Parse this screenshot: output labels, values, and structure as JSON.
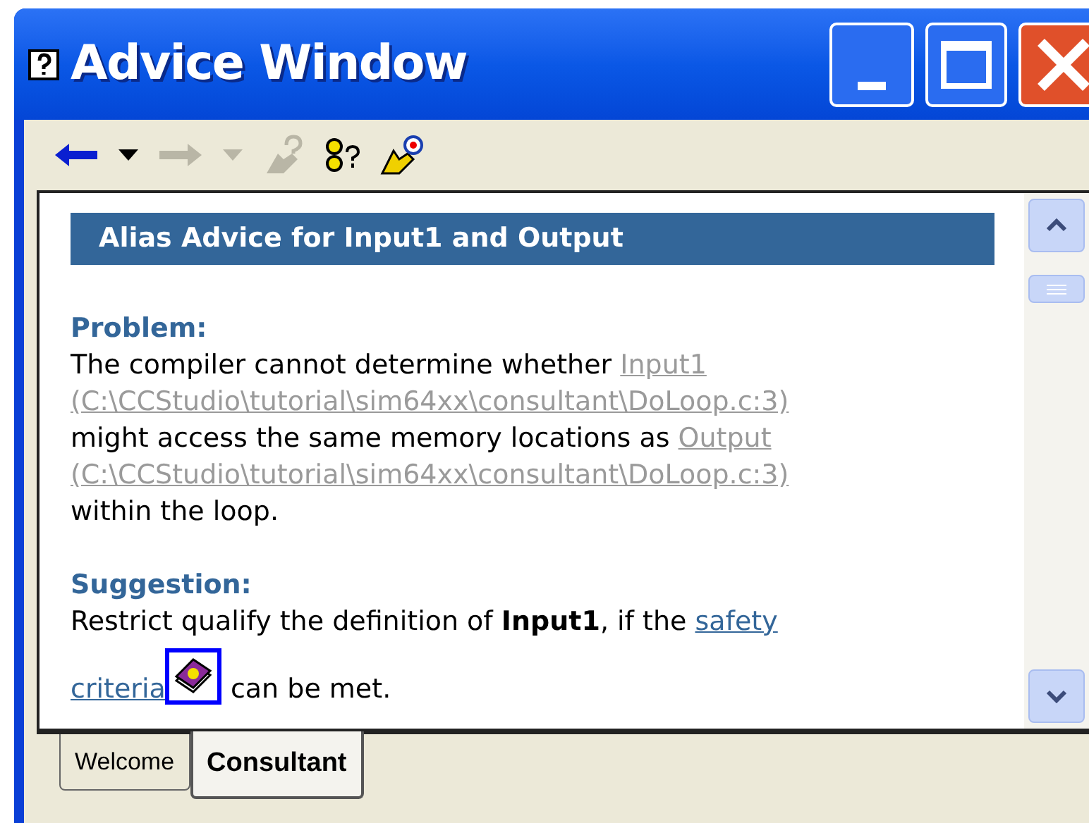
{
  "window": {
    "title": "Advice Window"
  },
  "toolbar": [
    {
      "kind": "back",
      "disabled": false
    },
    {
      "kind": "back_menu",
      "disabled": false
    },
    {
      "kind": "forward",
      "disabled": true
    },
    {
      "kind": "forward_menu",
      "disabled": true
    },
    {
      "kind": "hand_help",
      "disabled": true
    },
    {
      "kind": "help_query",
      "disabled": false
    },
    {
      "kind": "hand_target",
      "disabled": false
    }
  ],
  "advice": {
    "heading": "Alias Advice for Input1 and Output",
    "sections": [
      {
        "title": "Problem:",
        "lines": [
          [
            {
              "kind": "text",
              "text": "The compiler cannot determine whether "
            },
            {
              "kind": "visited_link",
              "text": "Input1"
            }
          ],
          [
            {
              "kind": "visited_link",
              "text": "(C:\\CCStudio\\tutorial\\sim64xx\\consultant\\DoLoop.c:3)"
            }
          ],
          [
            {
              "kind": "text",
              "text": "might access the same memory locations as "
            },
            {
              "kind": "visited_link",
              "text": "Output"
            }
          ],
          [
            {
              "kind": "visited_link",
              "text": "(C:\\CCStudio\\tutorial\\sim64xx\\consultant\\DoLoop.c:3)"
            }
          ],
          [
            {
              "kind": "text",
              "text": "within the loop."
            }
          ]
        ]
      },
      {
        "title": "Suggestion:",
        "lines": [
          [
            {
              "kind": "text",
              "text": "Restrict qualify the definition of "
            },
            {
              "kind": "bold",
              "text": "Input1"
            },
            {
              "kind": "text",
              "text": ", if the "
            },
            {
              "kind": "link",
              "text": "safety"
            }
          ],
          [
            {
              "kind": "link",
              "text": "criteria",
              "help_icon": true
            },
            {
              "kind": "text",
              "text": " can be met."
            }
          ]
        ]
      }
    ]
  },
  "tabs": [
    {
      "label": "Welcome",
      "selected": false
    },
    {
      "label": "Consultant",
      "selected": true
    }
  ]
}
